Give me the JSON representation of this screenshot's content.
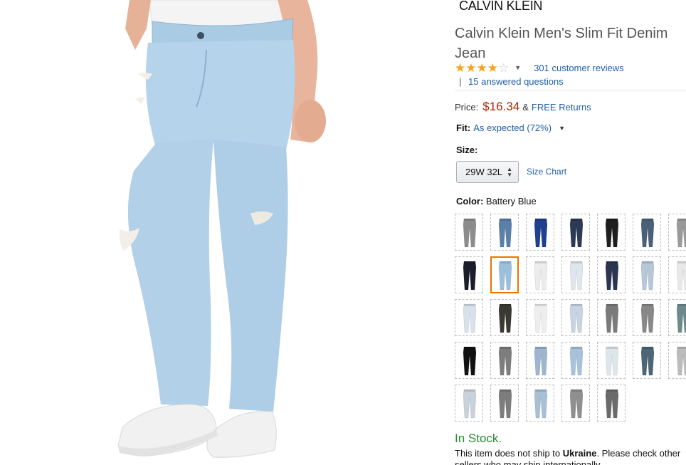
{
  "brand_logo_text": "CALVIN KLEIN",
  "product": {
    "title": "Calvin Klein Men's Slim Fit Denim Jean",
    "rating_stars": 4,
    "reviews_link": "301 customer reviews",
    "qa_separator": "|",
    "qa_link": "15 answered questions"
  },
  "price": {
    "label": "Price:",
    "value": "$16.34",
    "amp": "&",
    "returns": "FREE Returns"
  },
  "fit": {
    "label": "Fit:",
    "value": "As expected (72%)"
  },
  "size": {
    "label": "Size:",
    "selected": "29W 32L",
    "chart_link": "Size Chart"
  },
  "color": {
    "label": "Color:",
    "selected": "Battery Blue",
    "swatch_colors": [
      "#8c8c8c",
      "#5b7fa8",
      "#1f3f8f",
      "#2c3a55",
      "#1e1e1e",
      "#4a6079",
      "#9a9a9a",
      "#1a1f2b",
      "#9cc0dc",
      "#ececec",
      "#dfe6ec",
      "#2a3550",
      "#b6c7d8",
      "#e8e8e8",
      "#d9e2ea",
      "#3a3a33",
      "#eeeeee",
      "#c8d4e2",
      "#7a7a7a",
      "#888888",
      "#6d8b8a",
      "#111111",
      "#7d7d7d",
      "#9db5cf",
      "#a8c2dc",
      "#dde6ea",
      "#4c6577",
      "#bcbcbc",
      "#c9d2da",
      "#7c7c7c",
      "#a9bfd6",
      "#8f8f8f",
      "#6a6a6a"
    ],
    "selected_index": 8
  },
  "stock": {
    "status": "In Stock.",
    "note_prefix": "This item does not ship to ",
    "note_country": "Ukraine",
    "note_suffix": ". Please check other sellers who may ship internationally."
  }
}
